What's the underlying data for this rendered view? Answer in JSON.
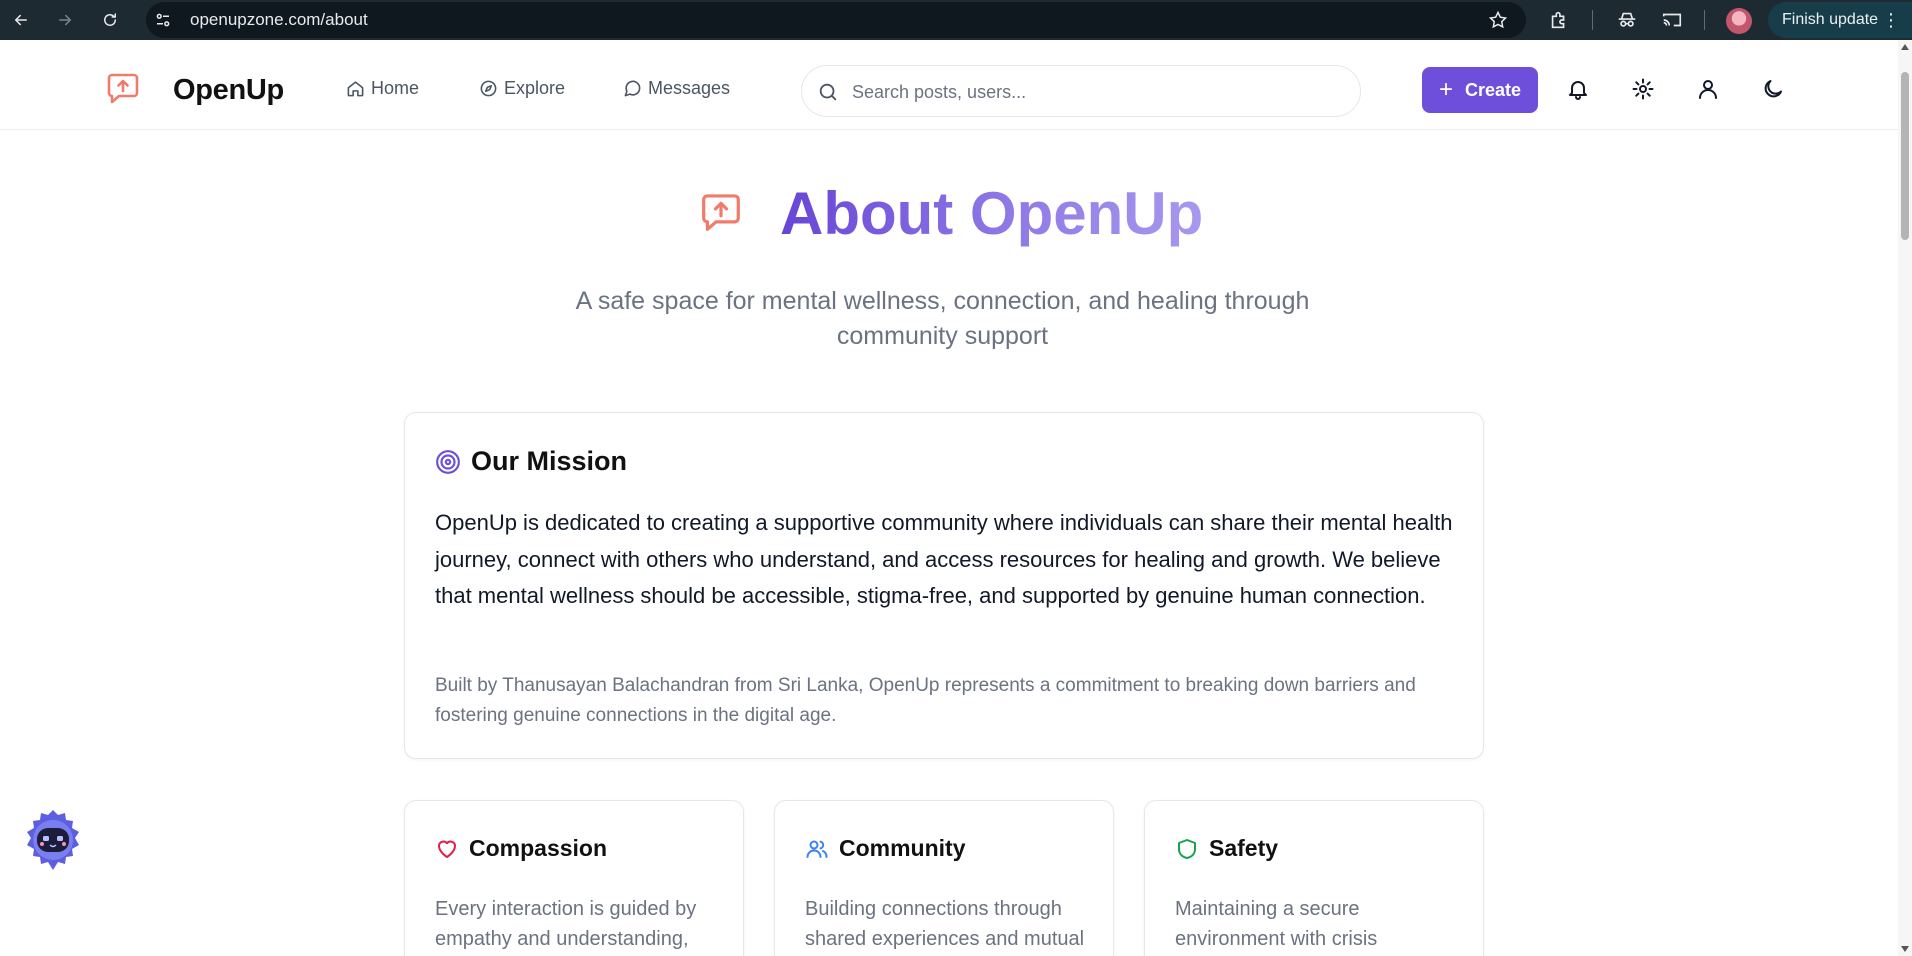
{
  "browser": {
    "url": "openupzone.com/about",
    "finish_update_label": "Finish update"
  },
  "header": {
    "brand": "OpenUp",
    "nav": [
      {
        "label": "Home"
      },
      {
        "label": "Explore"
      },
      {
        "label": "Messages"
      }
    ],
    "search_placeholder": "Search posts, users...",
    "create_label": "Create"
  },
  "hero": {
    "title": "About OpenUp",
    "subtitle": "A safe space for mental wellness, connection, and healing through community support"
  },
  "mission": {
    "title": "Our Mission",
    "body": "OpenUp is dedicated to creating a supportive community where individuals can share their mental health journey, connect with others who understand, and access resources for healing and growth. We believe that mental wellness should be accessible, stigma-free, and supported by genuine human connection.",
    "credit": "Built by Thanusayan Balachandran from Sri Lanka, OpenUp represents a commitment to breaking down barriers and fostering genuine connections in the digital age."
  },
  "values": [
    {
      "title": "Compassion",
      "text": "Every interaction is guided by empathy and understanding,",
      "icon": "heart-icon",
      "color": "#e11d48"
    },
    {
      "title": "Community",
      "text": "Building connections through shared experiences and mutual",
      "icon": "users-icon",
      "color": "#3b82f6"
    },
    {
      "title": "Safety",
      "text": "Maintaining a secure environment with crisis",
      "icon": "shield-icon",
      "color": "#16a34a"
    }
  ],
  "colors": {
    "brand_purple": "#6d4fdc",
    "logo_coral": "#f07b6a",
    "chrome_dark": "#1e2a32"
  }
}
